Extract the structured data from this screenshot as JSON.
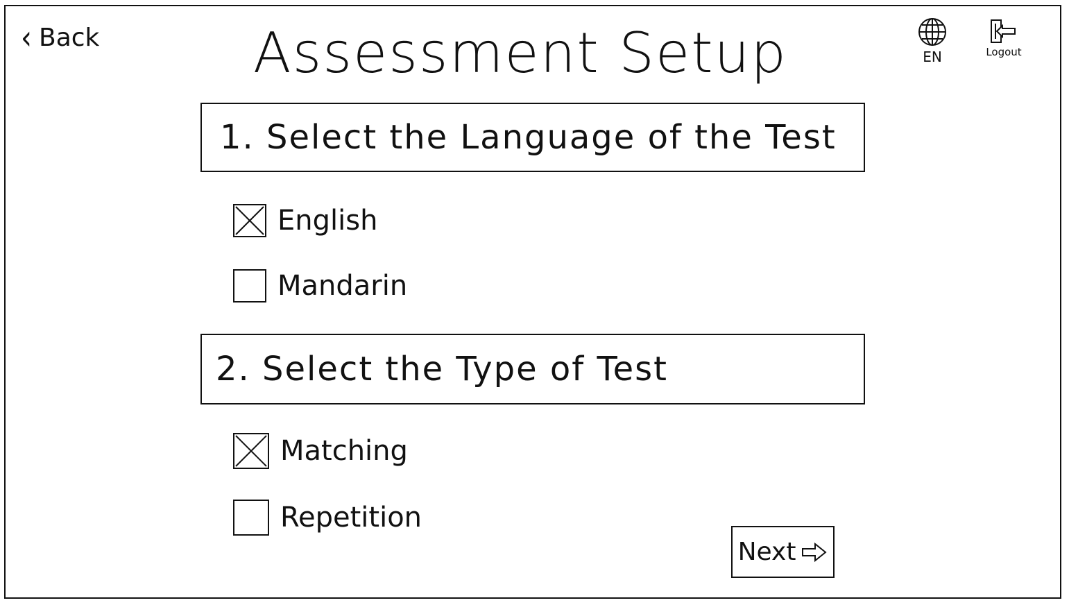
{
  "header": {
    "back_label": "Back",
    "title": "Assessment Setup",
    "language_code": "EN",
    "logout_label": "Logout"
  },
  "sections": [
    {
      "heading": "1. Select the Language of the Test",
      "options": [
        {
          "label": "English",
          "checked": true
        },
        {
          "label": "Mandarin",
          "checked": false
        }
      ]
    },
    {
      "heading": "2. Select the Type of Test",
      "options": [
        {
          "label": "Matching",
          "checked": true
        },
        {
          "label": "Repetition",
          "checked": false
        }
      ]
    }
  ],
  "footer": {
    "next_label": "Next"
  },
  "icons": {
    "back": "chevron-left-icon",
    "language": "globe-icon",
    "logout": "logout-door-arrow-icon",
    "next": "arrow-right-icon"
  }
}
